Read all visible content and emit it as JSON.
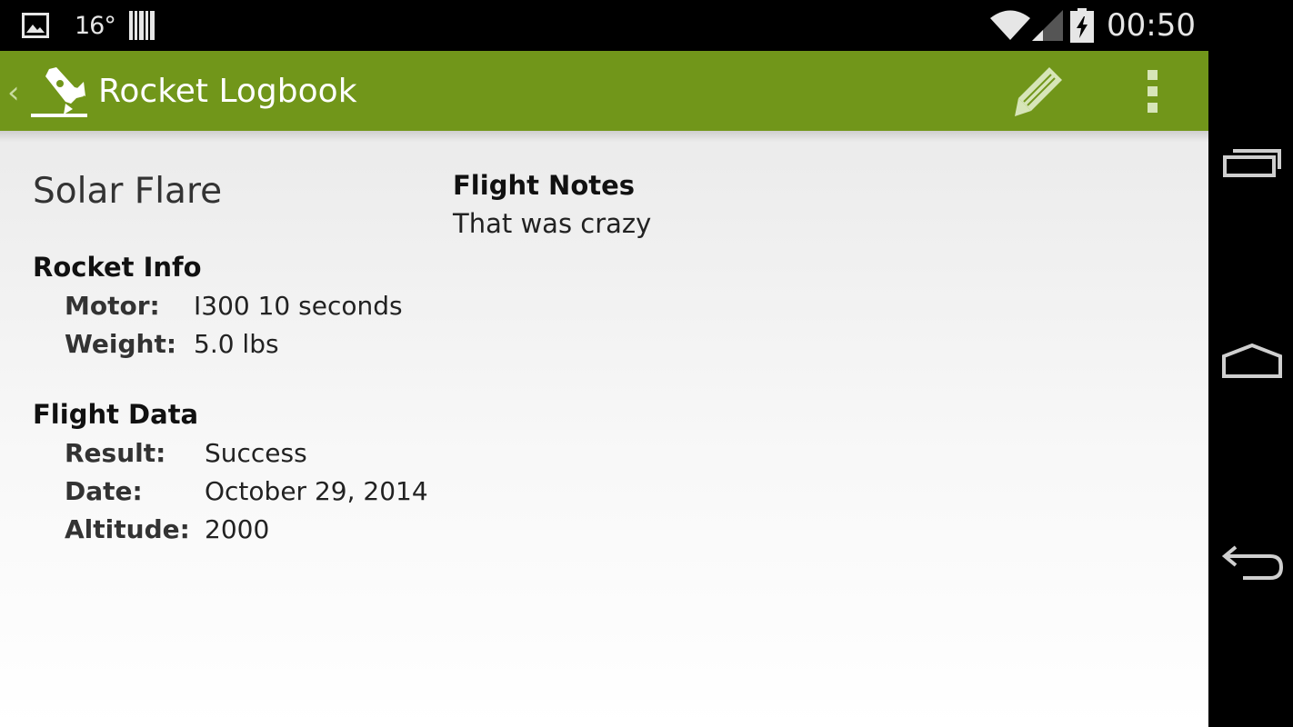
{
  "status_bar": {
    "temperature": "16°",
    "clock": "00:50",
    "icons": [
      "image-notification-icon",
      "barcode-notification-icon",
      "wifi-icon",
      "cell-signal-icon",
      "battery-charging-icon"
    ]
  },
  "action_bar": {
    "title": "Rocket Logbook",
    "up_caret": "‹",
    "background_color": "#71961a",
    "actions": [
      "pencil-edit-icon",
      "overflow-menu-icon"
    ]
  },
  "flight": {
    "rocket_name": "Solar Flare",
    "rocket_info": {
      "title": "Rocket Info",
      "motor_label": "Motor:",
      "motor_value": "I300 10 seconds",
      "weight_label": "Weight:",
      "weight_value": "5.0 lbs"
    },
    "flight_data": {
      "title": "Flight Data",
      "result_label": "Result:",
      "result_value": "Success",
      "date_label": "Date:",
      "date_value": "October 29, 2014",
      "altitude_label": "Altitude:",
      "altitude_value": "2000"
    },
    "notes": {
      "title": "Flight Notes",
      "text": "That was crazy"
    }
  },
  "nav_bar": {
    "buttons": [
      "recent-apps-icon",
      "home-icon",
      "back-icon"
    ]
  }
}
